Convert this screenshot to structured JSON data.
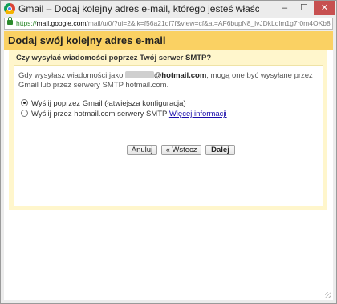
{
  "window": {
    "title": "Gmail – Dodaj kolejny adres e-mail, którego jesteś właścicielem - Google C...",
    "controls": {
      "minimize": "–",
      "maximize": "☐",
      "close": "✕"
    }
  },
  "addressbar": {
    "scheme": "https://",
    "host": "mail.google.com",
    "path": "/mail/u/0/?ui=2&ik=f56a21df7f&view=cf&at=AF6bupN8_lvJDkLdlm1g7r0m4OKb82b"
  },
  "dialog": {
    "header": "Dodaj swój kolejny adres e-mail",
    "question": "Czy wysyłać wiadomości poprzez Twój serwer SMTP?",
    "description": {
      "prefix": "Gdy wysyłasz wiadomości jako",
      "email_domain": "@hotmail.com",
      "suffix": ", mogą one być wysyłane przez Gmail lub przez serwery SMTP hotmail.com."
    },
    "options": [
      {
        "label": "Wyślij poprzez Gmail (łatwiejsza konfiguracja)",
        "checked": true
      },
      {
        "label": "Wyślij przez hotmail.com serwery SMTP",
        "link": "Więcej informacji",
        "checked": false
      }
    ],
    "buttons": {
      "cancel": "Anuluj",
      "back": "« Wstecz",
      "next": "Dalej"
    }
  },
  "colors": {
    "header_bg": "#fad163",
    "panel_bg": "#fff6cc",
    "link": "#1a0dab",
    "close_button": "#c75050"
  }
}
